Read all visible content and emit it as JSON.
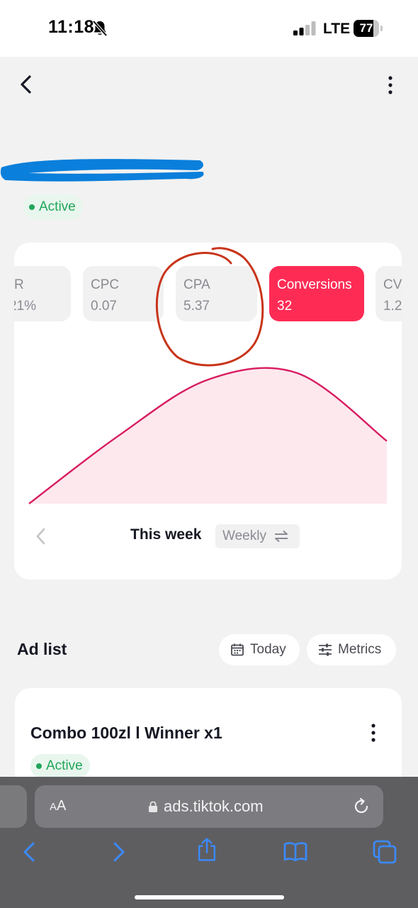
{
  "status_bar": {
    "time": "11:18",
    "network": "LTE",
    "battery": "77",
    "battery_level": 0.77
  },
  "campaign": {
    "status": "Active"
  },
  "metrics": [
    {
      "name": "R",
      "value": "21%",
      "active": false
    },
    {
      "name": "CPC",
      "value": "0.07",
      "active": false
    },
    {
      "name": "CPA",
      "value": "5.37",
      "active": false
    },
    {
      "name": "Conversions",
      "value": "32",
      "active": true
    },
    {
      "name": "CV",
      "value": "1.2",
      "active": false
    }
  ],
  "chart_data": {
    "type": "area",
    "series": [
      {
        "values": [
          0.0,
          0.52,
          0.95,
          1.0,
          0.48
        ]
      }
    ],
    "line_color": "#d81b60",
    "fill_color": "#fde8ee",
    "grid": false
  },
  "period": {
    "label": "This week",
    "granularity": "Weekly"
  },
  "ad_list": {
    "title": "Ad list",
    "date_filter": "Today",
    "metrics_button": "Metrics",
    "items": [
      {
        "name": "Combo 100zl l Winner x1",
        "status": "Active"
      }
    ]
  },
  "browser": {
    "text_size_label": "AA",
    "url": "ads.tiktok.com"
  },
  "colors": {
    "accent": "#fe2c55",
    "active_status": "#21a559",
    "annotation": "#c8341a",
    "redaction": "#0a7fdb"
  }
}
